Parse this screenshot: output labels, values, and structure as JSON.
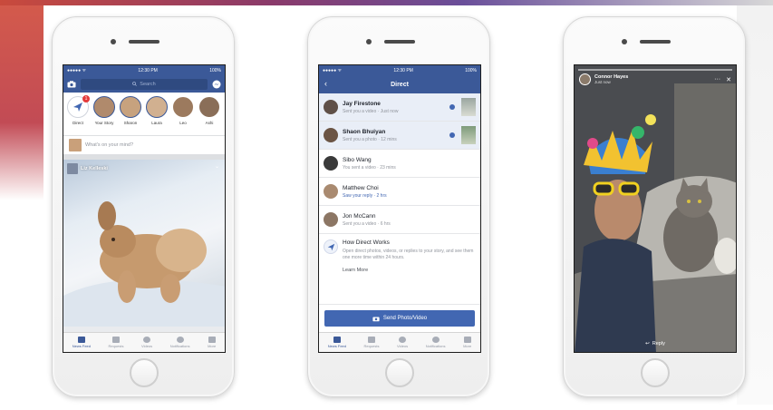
{
  "phone1": {
    "status": {
      "left": "●●●●● ᯤ",
      "time": "12:30 PM",
      "battery": "100%"
    },
    "search_placeholder": "Search",
    "stories": [
      {
        "label": "Direct",
        "badge": "1"
      },
      {
        "label": "Your Story"
      },
      {
        "label": "Sharon"
      },
      {
        "label": "Laura"
      },
      {
        "label": "Leo"
      },
      {
        "label": "Ashi"
      }
    ],
    "composer_placeholder": "What's on your mind?",
    "post_author": "Liz Kelleski",
    "tabs": [
      "News Feed",
      "Requests",
      "Videos",
      "Notifications",
      "More"
    ]
  },
  "phone2": {
    "status": {
      "left": "●●●●● ᯤ",
      "time": "12:30 PM",
      "battery": "100%"
    },
    "title": "Direct",
    "messages": [
      {
        "name": "Jay Firestone",
        "sub": "Sent you a video · Just now",
        "unread": true
      },
      {
        "name": "Shaon Bhuiyan",
        "sub": "Sent you a photo · 12 mins",
        "unread": true
      },
      {
        "name": "Sibo Wang",
        "sub": "You sent a video · 23 mins",
        "unread": false
      },
      {
        "name": "Matthew Choi",
        "sub": "Saw your reply · 2 hrs",
        "unread": false
      },
      {
        "name": "Jon McCann",
        "sub": "Sent you a video · 6 hrs",
        "unread": false
      }
    ],
    "how_title": "How Direct Works",
    "how_desc": "Open direct photos, videos, or replies to your story, and see them one more time within 24 hours.",
    "learn_more": "Learn More",
    "send_button": "Send Photo/Video",
    "tabs": [
      "News Feed",
      "Requests",
      "Videos",
      "Notifications",
      "More"
    ]
  },
  "phone3": {
    "author": "Connor Hayes",
    "time": "Just now",
    "reply_label": "Reply"
  }
}
